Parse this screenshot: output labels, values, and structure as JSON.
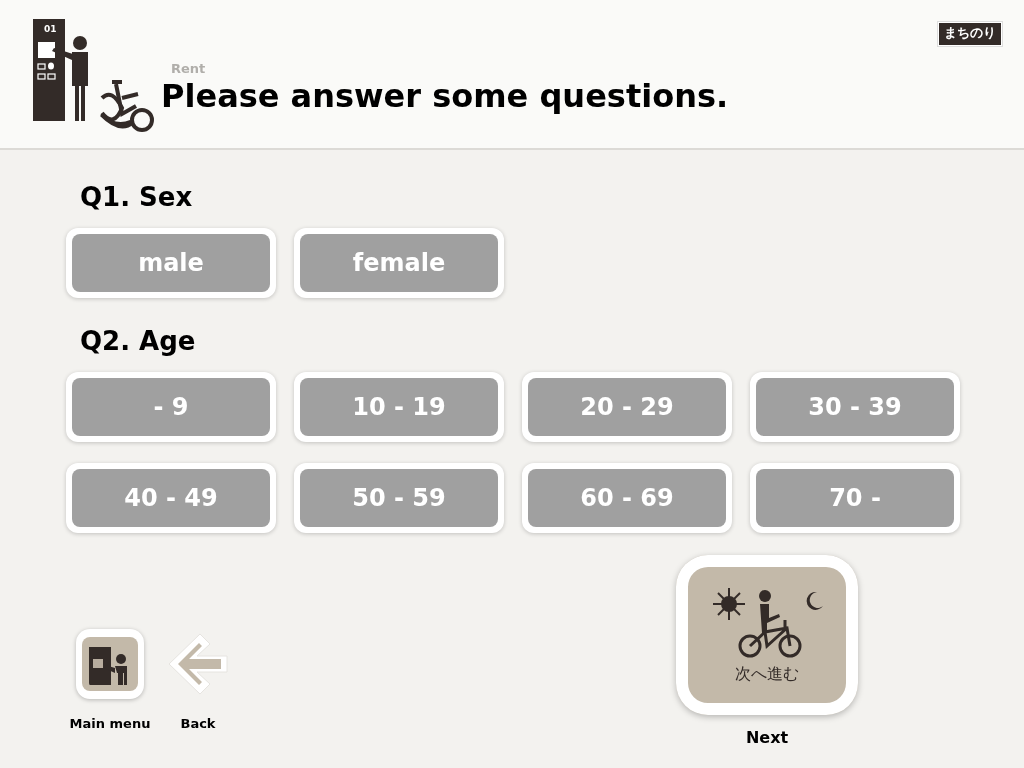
{
  "header": {
    "kiosk_number": "01",
    "breadcrumb": "Rent",
    "title": "Please answer some questions.",
    "logo": "まちのり"
  },
  "questions": [
    {
      "label": "Q1. Sex",
      "options": [
        {
          "label": "male",
          "selected": false
        },
        {
          "label": "female",
          "selected": false
        }
      ]
    },
    {
      "label": "Q2. Age",
      "options": [
        {
          "label": "- 9",
          "selected": false
        },
        {
          "label": "10 - 19",
          "selected": false
        },
        {
          "label": "20 - 29",
          "selected": false
        },
        {
          "label": "30 - 39",
          "selected": false
        },
        {
          "label": "40 - 49",
          "selected": false
        },
        {
          "label": "50 - 59",
          "selected": false
        },
        {
          "label": "60 - 69",
          "selected": false
        },
        {
          "label": "70 -",
          "selected": false
        }
      ]
    }
  ],
  "footer": {
    "main_menu": "Main menu",
    "back": "Back",
    "next_caption": "次へ進む",
    "next": "Next"
  }
}
